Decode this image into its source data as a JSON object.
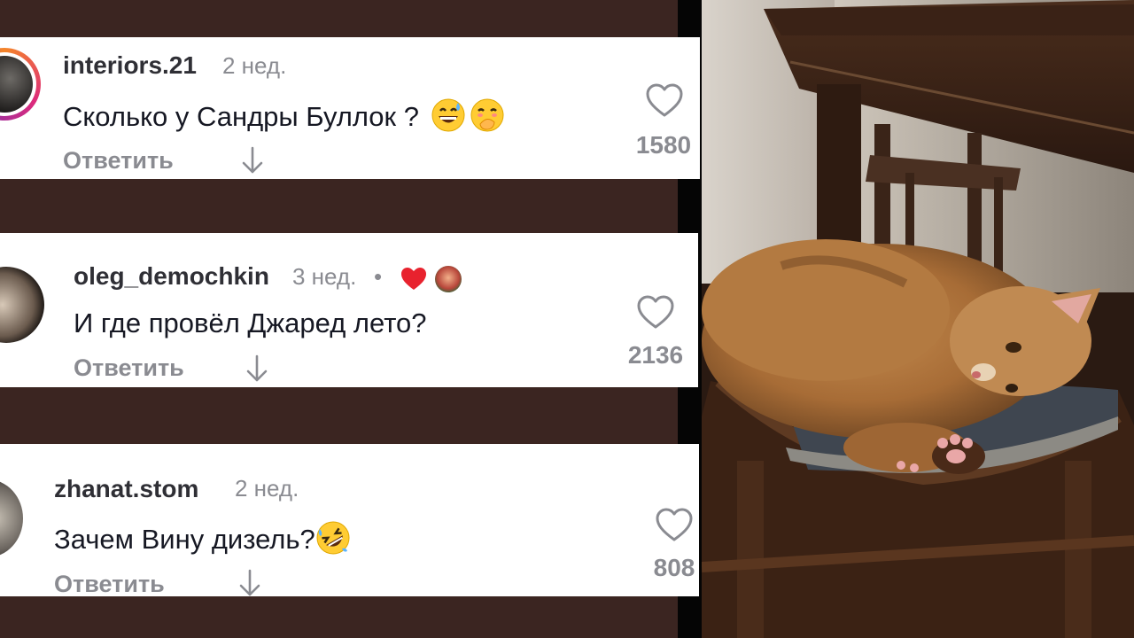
{
  "comments": [
    {
      "username": "interiors.21",
      "time": "2 нед.",
      "text": "Сколько у Сандры Буллок ? ",
      "emojis": [
        "grinning-sweat",
        "hand-over-mouth"
      ],
      "reply_label": "Ответить",
      "likes": "1580"
    },
    {
      "username": "oleg_demochkin",
      "time": "3 нед.",
      "separator": "•",
      "text": "И где провёл Джаред лето?",
      "reply_label": "Ответить",
      "likes": "2136"
    },
    {
      "username": "zhanat.stom",
      "time": "2 нед.",
      "text": "Зачем Вину дизель?",
      "emojis": [
        "rolling-laughing"
      ],
      "reply_label": "Ответить",
      "likes": "808"
    }
  ],
  "colors": {
    "background": "#3b2521",
    "card": "#ffffff",
    "muted": "#8a8b91",
    "heart_red": "#e8222e"
  }
}
